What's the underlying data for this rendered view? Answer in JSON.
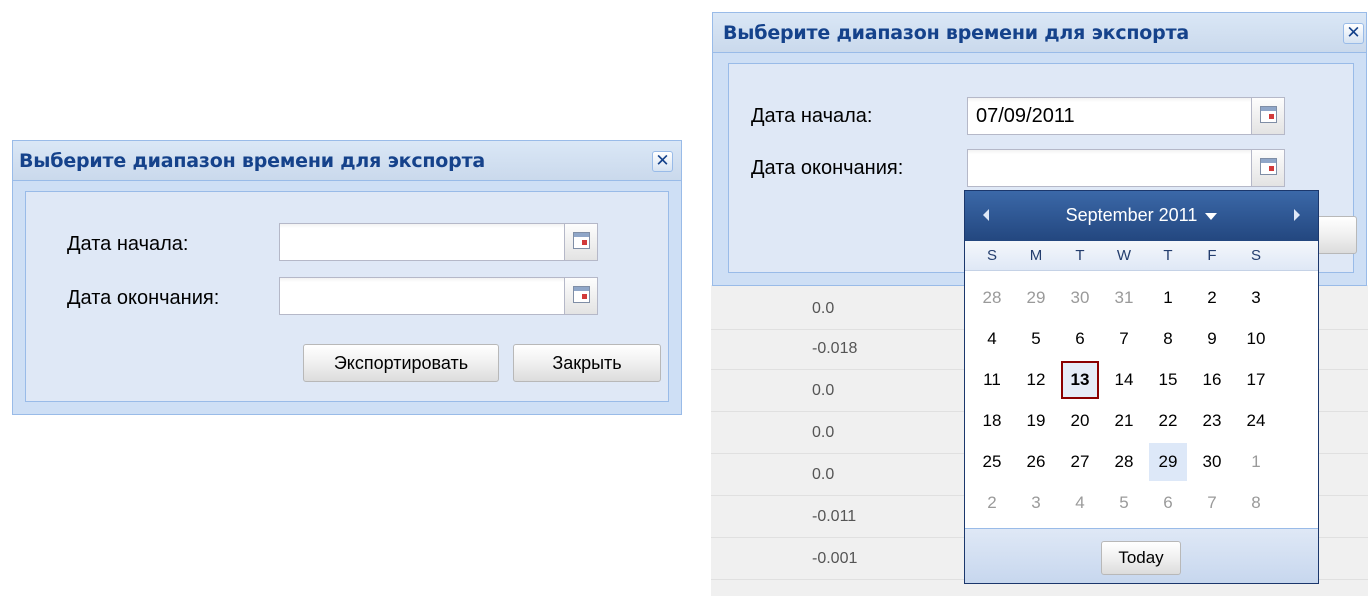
{
  "left_dialog": {
    "title": "Выберите диапазон времени для экспорта",
    "close": "✕",
    "start_label": "Дата начала:",
    "end_label": "Дата окончания:",
    "start_value": "",
    "end_value": "",
    "export_button": "Экспортировать",
    "close_button": "Закрыть"
  },
  "right_dialog": {
    "title": "Выберите диапазон времени для экспорта",
    "close": "✕",
    "start_label": "Дата начала:",
    "end_label": "Дата окончания:",
    "start_value": "07/09/2011",
    "end_value": ""
  },
  "grid_values": [
    "0.0",
    "-0.018",
    "0.0",
    "0.0",
    "0.0",
    "-0.011",
    "-0.001"
  ],
  "date_picker": {
    "month_label": "September 2011",
    "weekdays": [
      "S",
      "M",
      "T",
      "W",
      "T",
      "F",
      "S"
    ],
    "weeks": [
      [
        "28",
        "29",
        "30",
        "31",
        "1",
        "2",
        "3"
      ],
      [
        "4",
        "5",
        "6",
        "7",
        "8",
        "9",
        "10"
      ],
      [
        "11",
        "12",
        "13",
        "14",
        "15",
        "16",
        "17"
      ],
      [
        "18",
        "19",
        "20",
        "21",
        "22",
        "23",
        "24"
      ],
      [
        "25",
        "26",
        "27",
        "28",
        "29",
        "30",
        "1"
      ],
      [
        "2",
        "3",
        "4",
        "5",
        "6",
        "7",
        "8"
      ]
    ],
    "today_button": "Today"
  }
}
